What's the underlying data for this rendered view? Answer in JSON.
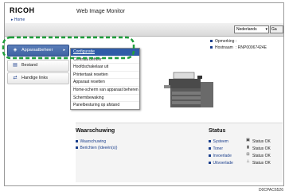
{
  "header": {
    "logo": "RICOH",
    "title": "Web Image Monitor",
    "home_link": "▸ Home",
    "language": "Nederlands",
    "go_button": "Ga"
  },
  "sidebar": {
    "items": [
      {
        "label": "Apparaatbeheer",
        "icon": "device-icon"
      },
      {
        "label": "Bestand",
        "icon": "document-icon"
      },
      {
        "label": "Handige links",
        "icon": "link-icon"
      }
    ]
  },
  "submenu": {
    "items": [
      "Configuratie",
      "Centraal beheer",
      "Hoofdschakelaar uit",
      "Printertaak resetten",
      "Apparaat resetten",
      "Home-scherm van apparaat beheren",
      "Schermbewaking",
      "Panelbesturing op afstand"
    ]
  },
  "device_info": {
    "location_label": "Opmerking",
    "location_value": ":",
    "host_label": "Hostnaam",
    "host_value": ": RNP00067424E"
  },
  "warning_section": {
    "title": "Waarschuwing",
    "items": [
      "Waarschuwing",
      "Berichten (Ideeën(s))"
    ]
  },
  "status_section": {
    "title": "Status",
    "items": [
      {
        "label": "Systeem",
        "status": "Status OK",
        "icon": "system-status-icon"
      },
      {
        "label": "Toner",
        "status": "Status OK",
        "icon": "toner-status-icon"
      },
      {
        "label": "Invoerlade",
        "status": "Status OK",
        "icon": "input-tray-icon"
      },
      {
        "label": "Uitvoerlade",
        "status": "Status OK",
        "icon": "output-tray-icon"
      }
    ]
  },
  "caption": "D0CPAC6526",
  "colors": {
    "accent": "#2f5ca8",
    "highlight_border": "#1e9e3c",
    "link": "#1a3e8c"
  }
}
